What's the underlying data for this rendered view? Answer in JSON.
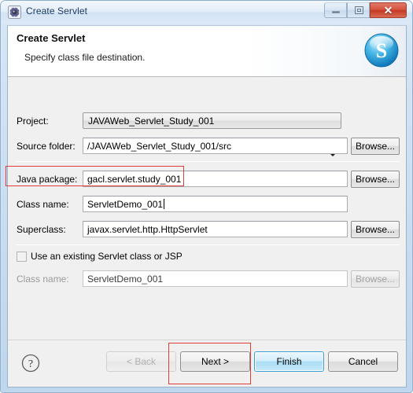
{
  "window": {
    "title": "Create Servlet",
    "title_icon": "servlet-gear-icon",
    "controls": {
      "minimize": "minimize-icon",
      "maximize": "maximize-icon",
      "close": "✕"
    }
  },
  "banner": {
    "title": "Create Servlet",
    "subtitle": "Specify class file destination.",
    "logo": "S"
  },
  "form": {
    "project": {
      "label": "Project:",
      "value": "JAVAWeb_Servlet_Study_001"
    },
    "source_folder": {
      "label": "Source folder:",
      "value": "/JAVAWeb_Servlet_Study_001/src",
      "browse": "Browse..."
    },
    "java_package": {
      "label": "Java package:",
      "value": "gacl.servlet.study_001",
      "browse": "Browse..."
    },
    "class_name": {
      "label": "Class name:",
      "value": "ServletDemo_001"
    },
    "superclass": {
      "label": "Superclass:",
      "value": "javax.servlet.http.HttpServlet",
      "browse": "Browse..."
    },
    "use_existing": {
      "label": "Use an existing Servlet class or JSP",
      "checked": false
    },
    "existing_class_name": {
      "label": "Class name:",
      "value": "ServletDemo_001",
      "browse": "Browse..."
    }
  },
  "buttons": {
    "help": "?",
    "back": "< Back",
    "next": "Next >",
    "finish": "Finish",
    "cancel": "Cancel"
  },
  "annotations": {
    "color": "#e13c3c",
    "targets": [
      "class-name-row",
      "next-button"
    ]
  }
}
